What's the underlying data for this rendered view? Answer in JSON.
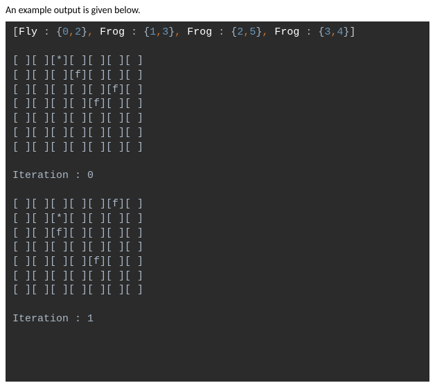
{
  "intro": "An example output is given below.",
  "header": {
    "open_bracket": "[",
    "entries": [
      {
        "label": "Fly",
        "x": "0",
        "y": "2"
      },
      {
        "label": "Frog",
        "x": "1",
        "y": "3"
      },
      {
        "label": "Frog",
        "x": "2",
        "y": "5"
      },
      {
        "label": "Frog",
        "x": "3",
        "y": "4"
      }
    ],
    "close_bracket": "]",
    "colon_pad": " : ",
    "sep": ", "
  },
  "grid0": [
    "[ ][ ][*][ ][ ][ ][ ]",
    "[ ][ ][ ][f][ ][ ][ ]",
    "[ ][ ][ ][ ][ ][f][ ]",
    "[ ][ ][ ][ ][f][ ][ ]",
    "[ ][ ][ ][ ][ ][ ][ ]",
    "[ ][ ][ ][ ][ ][ ][ ]",
    "[ ][ ][ ][ ][ ][ ][ ]"
  ],
  "iter0_label": "Iteration : 0",
  "grid1": [
    "[ ][ ][ ][ ][ ][f][ ]",
    "[ ][ ][*][ ][ ][ ][ ]",
    "[ ][ ][f][ ][ ][ ][ ]",
    "[ ][ ][ ][ ][ ][ ][ ]",
    "[ ][ ][ ][ ][f][ ][ ]",
    "[ ][ ][ ][ ][ ][ ][ ]",
    "[ ][ ][ ][ ][ ][ ][ ]"
  ],
  "iter1_label": "Iteration : 1"
}
